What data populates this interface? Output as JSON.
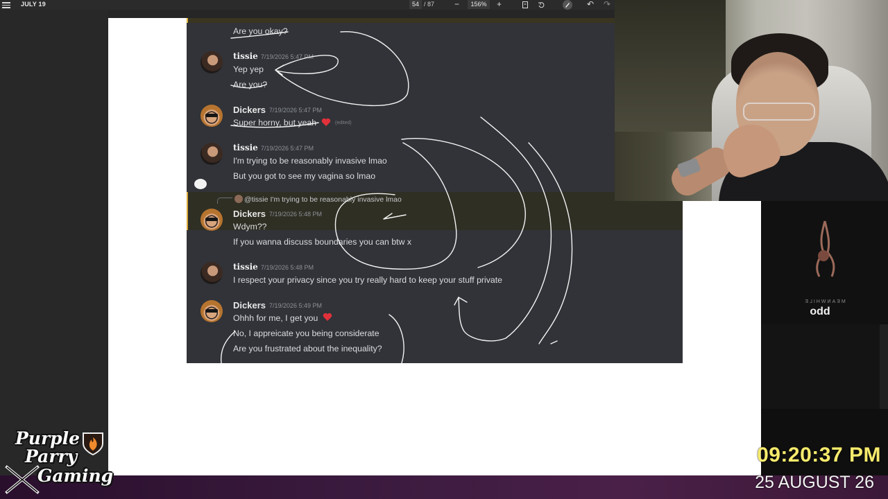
{
  "viewer": {
    "title": "JULY 19",
    "page_current": "54",
    "page_total": "/ 87",
    "zoom": "156%",
    "zoom_out": "−",
    "zoom_in": "+",
    "undo": "↶",
    "redo": "↷"
  },
  "chat": {
    "top_cut_text": "",
    "messages": [
      {
        "text": "Are you okay?"
      },
      {
        "author": "tissie",
        "time": "7/19/2026 5:47 PM",
        "lines": [
          "Yep yep",
          "Are you?"
        ]
      },
      {
        "author": "Dickers",
        "time": "7/19/2026 5:47 PM",
        "lines": [
          "Super horny, but yeah"
        ],
        "edited": "(edited)"
      },
      {
        "author": "tissie",
        "time": "7/19/2026 5:47 PM",
        "lines": [
          "I'm trying to be reasonably invasive lmao",
          "But you got to see my vagina so lmao"
        ]
      },
      {
        "reply_author": "@tissie",
        "reply_text": "I'm trying to be reasonably invasive lmao",
        "author": "Dickers",
        "time": "7/19/2026 5:48 PM",
        "lines": [
          "Wdym??",
          "If you wanna discuss boundaries you can btw x"
        ]
      },
      {
        "author": "tissie",
        "time": "7/19/2026 5:48 PM",
        "lines": [
          "I respect your privacy since you try really hard to keep your stuff private"
        ]
      },
      {
        "author": "Dickers",
        "time": "7/19/2026 5:49 PM",
        "lines": [
          "Ohhh for me, I get you",
          "No, I appreicate you being considerate",
          "Are you frustrated about the inequality?"
        ]
      }
    ]
  },
  "music": {
    "album_small": "MEANWHILE",
    "album_title": "odd"
  },
  "clock": {
    "time": "09:20:37 PM",
    "date": "25 AUGUST 26"
  },
  "logo": {
    "line1": "Purple",
    "line2": "Parry",
    "line3": "Gaming"
  },
  "colors": {
    "accent_clock": "#f6ea6c",
    "chat_bg": "#313338",
    "heart": "#e0313b",
    "bar_purple": "#3a1a3e"
  }
}
